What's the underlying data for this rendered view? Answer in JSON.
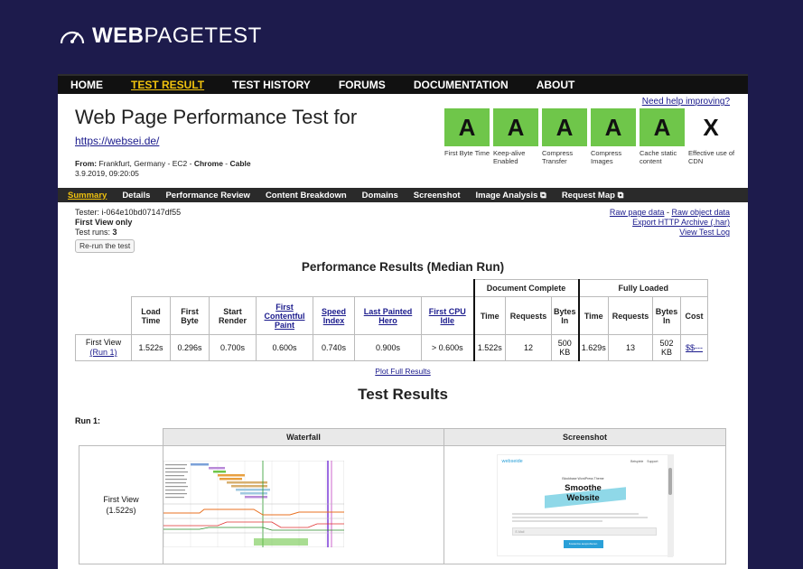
{
  "logo": {
    "bold": "WEB",
    "light": "PAGETEST",
    "icon": "speedometer-icon"
  },
  "nav": [
    {
      "label": "HOME",
      "active": false
    },
    {
      "label": "TEST RESULT",
      "active": true
    },
    {
      "label": "TEST HISTORY",
      "active": false
    },
    {
      "label": "FORUMS",
      "active": false
    },
    {
      "label": "DOCUMENTATION",
      "active": false
    },
    {
      "label": "ABOUT",
      "active": false
    }
  ],
  "help_link": "Need help improving?",
  "page_title": "Web Page Performance Test for",
  "test_url": "https://websei.de/",
  "from": {
    "label": "From:",
    "location": "Frankfurt, Germany - EC2 -",
    "browser": "Chrome",
    "sep": " - ",
    "connection": "Cable",
    "datetime": "3.9.2019, 09:20:05"
  },
  "grades": [
    {
      "grade": "A",
      "label": "First Byte Time"
    },
    {
      "grade": "A",
      "label": "Keep-alive Enabled"
    },
    {
      "grade": "A",
      "label": "Compress Transfer"
    },
    {
      "grade": "A",
      "label": "Compress Images"
    },
    {
      "grade": "A",
      "label": "Cache static content"
    },
    {
      "grade": "X",
      "label": "Effective use of CDN"
    }
  ],
  "subnav": [
    {
      "label": "Summary",
      "active": true,
      "ext": ""
    },
    {
      "label": "Details",
      "active": false,
      "ext": ""
    },
    {
      "label": "Performance Review",
      "active": false,
      "ext": ""
    },
    {
      "label": "Content Breakdown",
      "active": false,
      "ext": ""
    },
    {
      "label": "Domains",
      "active": false,
      "ext": ""
    },
    {
      "label": "Screenshot",
      "active": false,
      "ext": ""
    },
    {
      "label": "Image Analysis",
      "active": false,
      "ext": "⧉"
    },
    {
      "label": "Request Map",
      "active": false,
      "ext": "⧉"
    }
  ],
  "tester": {
    "line": "Tester: i-064e10bd07147df55",
    "view": "First View only",
    "runs_label": "Test runs: ",
    "runs": "3",
    "rerun": "Re-run the test"
  },
  "raw": {
    "page": "Raw page data",
    "dash": " - ",
    "object": "Raw object data",
    "har": "Export HTTP Archive (.har)",
    "log": "View Test Log"
  },
  "perf": {
    "heading": "Performance Results (Median Run)",
    "group_doc": "Document Complete",
    "group_full": "Fully Loaded",
    "cols": [
      "Load Time",
      "First Byte",
      "Start Render",
      "First Contentful Paint",
      "Speed Index",
      "Last Painted Hero",
      "First CPU Idle"
    ],
    "doc_cols": [
      "Time",
      "Requests",
      "Bytes In"
    ],
    "full_cols": [
      "Time",
      "Requests",
      "Bytes In",
      "Cost"
    ],
    "row": {
      "label": "First View",
      "run": "(Run 1)",
      "values": [
        "1.522s",
        "0.296s",
        "0.700s",
        "0.600s",
        "0.740s",
        "0.900s",
        "> 0.600s"
      ],
      "doc": [
        "1.522s",
        "12",
        "500 KB"
      ],
      "full": [
        "1.629s",
        "13",
        "502 KB"
      ],
      "cost": "$$---"
    }
  },
  "plot_link": "Plot Full Results",
  "test_results": {
    "heading": "Test Results",
    "run": "Run 1:",
    "col_waterfall": "Waterfall",
    "col_screenshot": "Screenshot",
    "row_label": "First View",
    "row_time": "(1.522s)"
  },
  "screenshot": {
    "brand": "webseide",
    "nav1": "Beispiele",
    "nav2": "Support",
    "eyebrow": "Blockbase WordPress Theme",
    "hero1": "Smoothe",
    "hero2": "Website",
    "field": "E-Mail",
    "button": "Kostenlos ausprobieren",
    "accent": "#8fd8e8",
    "button_color": "#2aa0d8"
  }
}
